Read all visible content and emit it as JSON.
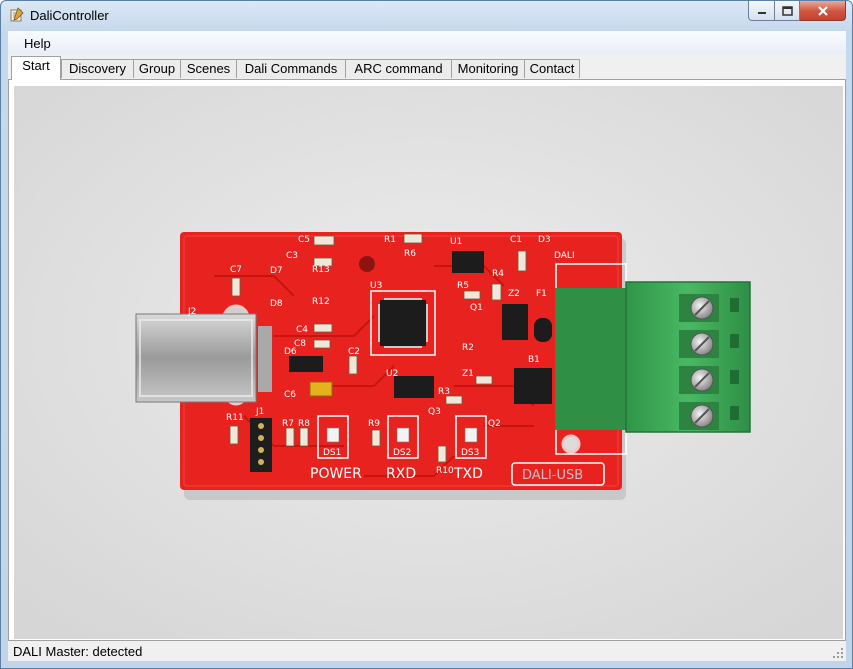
{
  "window": {
    "title": "DaliController"
  },
  "menu": {
    "items": [
      {
        "label": "Help"
      }
    ]
  },
  "tabs": [
    {
      "label": "Start",
      "active": true
    },
    {
      "label": "Discovery"
    },
    {
      "label": "Group"
    },
    {
      "label": "Scenes"
    },
    {
      "label": "Dali Commands"
    },
    {
      "label": "ARC command"
    },
    {
      "label": "Monitoring"
    },
    {
      "label": "Contact"
    }
  ],
  "board": {
    "designators": [
      "C5",
      "R1",
      "U1",
      "C1",
      "D3",
      "DALI",
      "C3",
      "R6",
      "C7",
      "D7",
      "R13",
      "R4",
      "J2",
      "U3",
      "R5",
      "Z2",
      "F1",
      "D8",
      "R12",
      "Q1",
      "C4",
      "C8",
      "D6",
      "C2",
      "R2",
      "B1",
      "U2",
      "Z1",
      "C6",
      "R3",
      "R11",
      "J1",
      "R7",
      "R8",
      "R9",
      "Q3",
      "Q2",
      "DS1",
      "DS2",
      "DS3",
      "R10"
    ],
    "led_labels": [
      "POWER",
      "RXD",
      "TXD"
    ],
    "silk_text": "DALI-USB"
  },
  "status": {
    "text": "DALI Master: detected"
  },
  "colors": {
    "pcb": "#e8231f",
    "terminal": "#3fae5a",
    "window_frame": "#c2d4ea"
  }
}
